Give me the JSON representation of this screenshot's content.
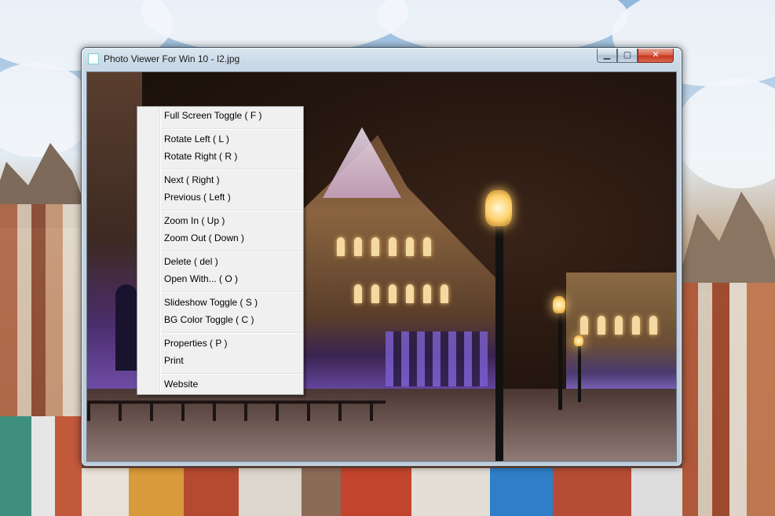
{
  "window": {
    "title": "Photo Viewer For Win 10 - I2.jpg",
    "caption_buttons": {
      "minimize_glyph": "▁",
      "maximize_glyph": "▢",
      "close_glyph": "✕"
    }
  },
  "image": {
    "file_name": "I2.jpg",
    "subject_icon": "night-square-photo"
  },
  "context_menu": {
    "groups": [
      [
        {
          "label": "Full Screen Toggle  ( F )"
        }
      ],
      [
        {
          "label": "Rotate Left  ( L )"
        },
        {
          "label": "Rotate Right  ( R )"
        }
      ],
      [
        {
          "label": "Next  ( Right )"
        },
        {
          "label": "Previous  ( Left )"
        }
      ],
      [
        {
          "label": "Zoom In  ( Up )"
        },
        {
          "label": "Zoom Out  ( Down )"
        }
      ],
      [
        {
          "label": "Delete  ( del )"
        },
        {
          "label": "Open With...  ( O )"
        }
      ],
      [
        {
          "label": "Slideshow Toggle ( S )"
        },
        {
          "label": "BG Color Toggle  ( C )"
        }
      ],
      [
        {
          "label": "Properties  ( P )"
        },
        {
          "label": "Print"
        }
      ],
      [
        {
          "label": "Website"
        }
      ]
    ]
  },
  "colors": {
    "menu_background": "#f0f0f0",
    "close_button": "#c4361e",
    "window_frame": "#c9d8e7"
  }
}
